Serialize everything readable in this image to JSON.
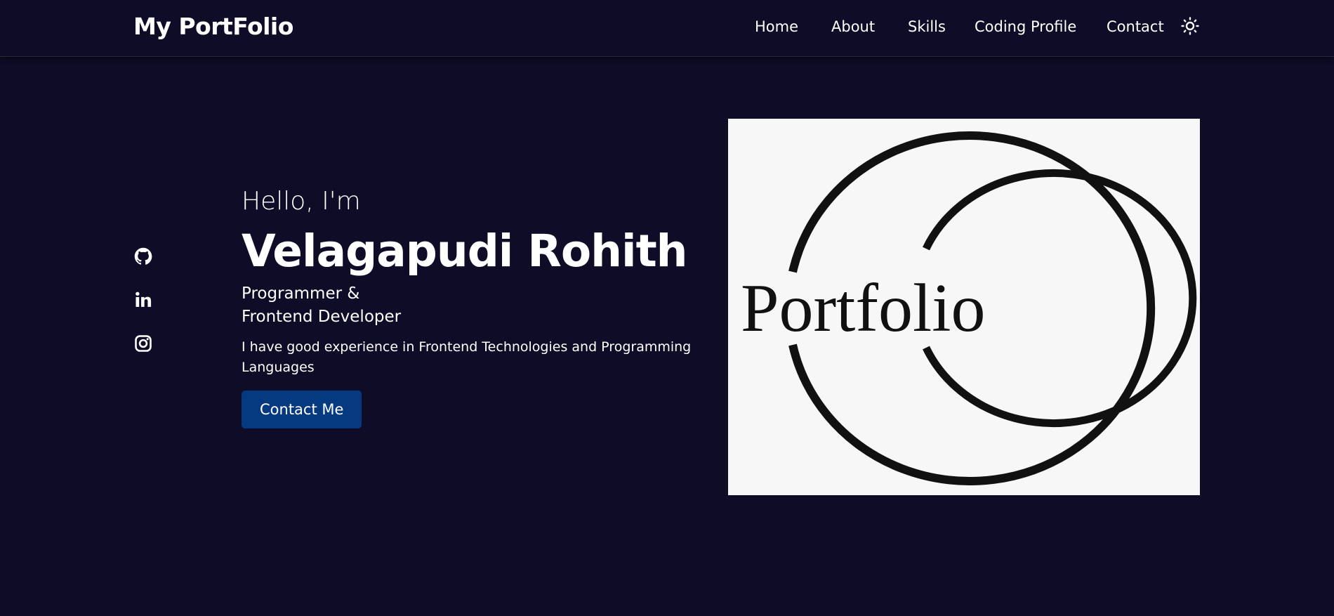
{
  "header": {
    "logo": "My PortFolio",
    "nav": [
      {
        "label": "Home"
      },
      {
        "label": "About"
      },
      {
        "label": "Skills"
      },
      {
        "label": "Coding Profile"
      },
      {
        "label": "Contact"
      }
    ],
    "theme_toggle_icon": "sun-icon"
  },
  "social": [
    {
      "icon": "github-icon"
    },
    {
      "icon": "linkedin-icon"
    },
    {
      "icon": "instagram-icon"
    }
  ],
  "hero": {
    "greeting": "Hello, I'm",
    "name": "Velagapudi Rohith",
    "role_line1": "Programmer &",
    "role_line2": "Frontend Developer",
    "description": "I have good experience in Frontend Technologies and Programming Languages",
    "button_label": "Contact Me",
    "image_text": "Portfolio"
  },
  "colors": {
    "background": "#0e0c26",
    "button": "#063a80",
    "image_bg": "#f7f7f7",
    "text": "#ffffff"
  }
}
